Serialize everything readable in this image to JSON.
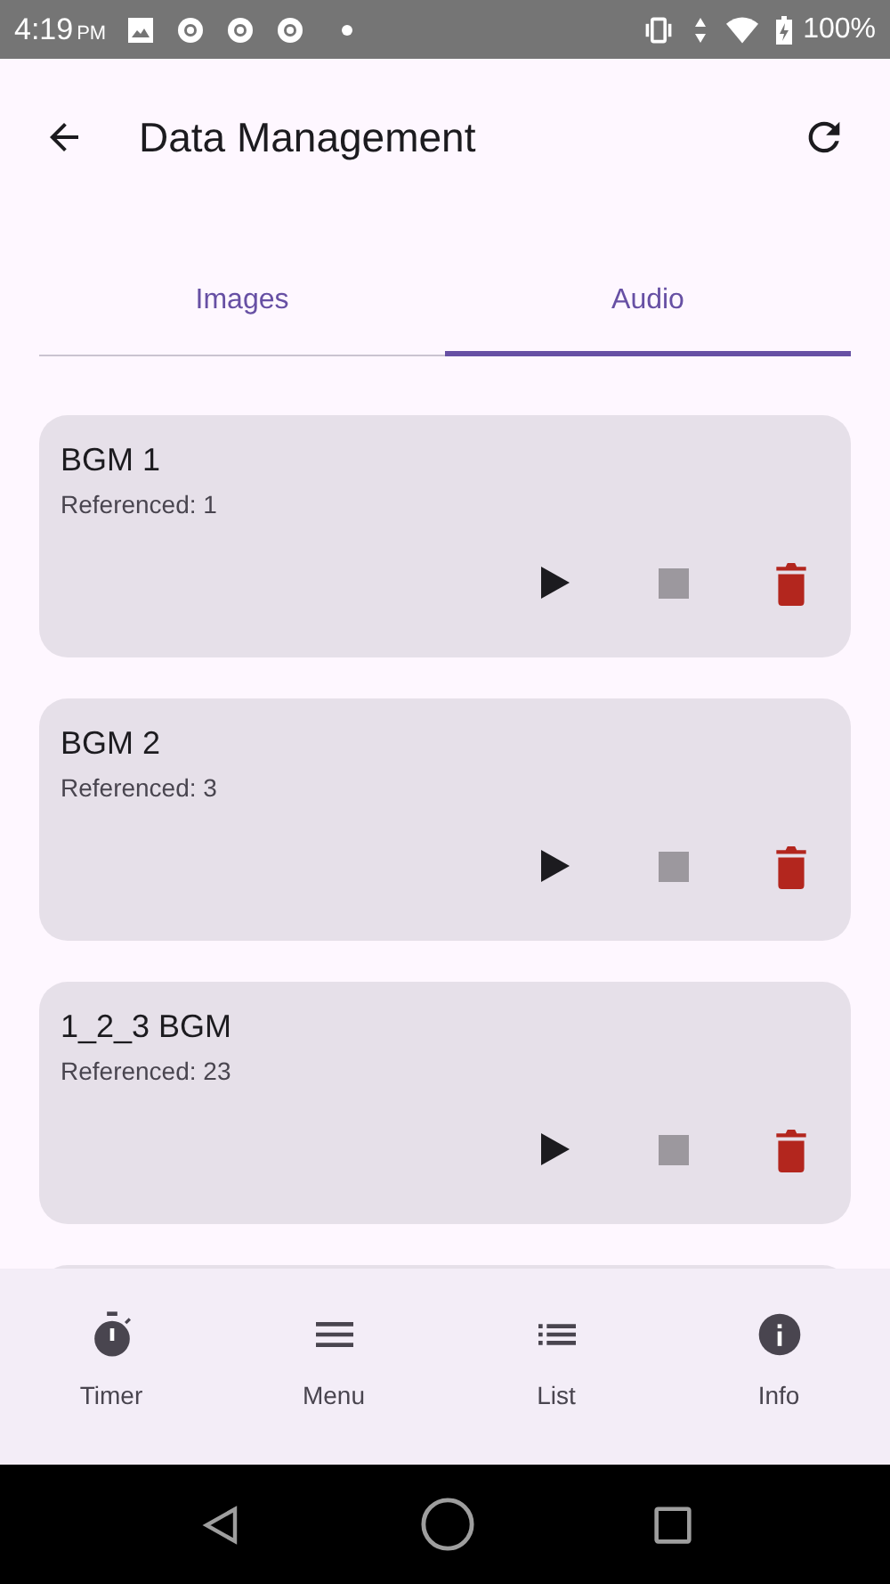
{
  "status_bar": {
    "time": "4:19",
    "ampm": "PM",
    "battery": "100%"
  },
  "app_bar": {
    "title": "Data Management"
  },
  "tabs": [
    {
      "label": "Images",
      "selected": false
    },
    {
      "label": "Audio",
      "selected": true
    }
  ],
  "items": [
    {
      "name": "BGM 1",
      "referenced": "Referenced: 1",
      "stop_disabled": true
    },
    {
      "name": "BGM 2",
      "referenced": "Referenced: 3",
      "stop_disabled": true
    },
    {
      "name": "1_2_3 BGM",
      "referenced": "Referenced: 23",
      "stop_disabled": true
    }
  ],
  "bottom_nav": [
    {
      "label": "Timer",
      "kind": "timer"
    },
    {
      "label": "Menu",
      "kind": "menu"
    },
    {
      "label": "List",
      "kind": "list"
    },
    {
      "label": "Info",
      "kind": "info"
    }
  ]
}
